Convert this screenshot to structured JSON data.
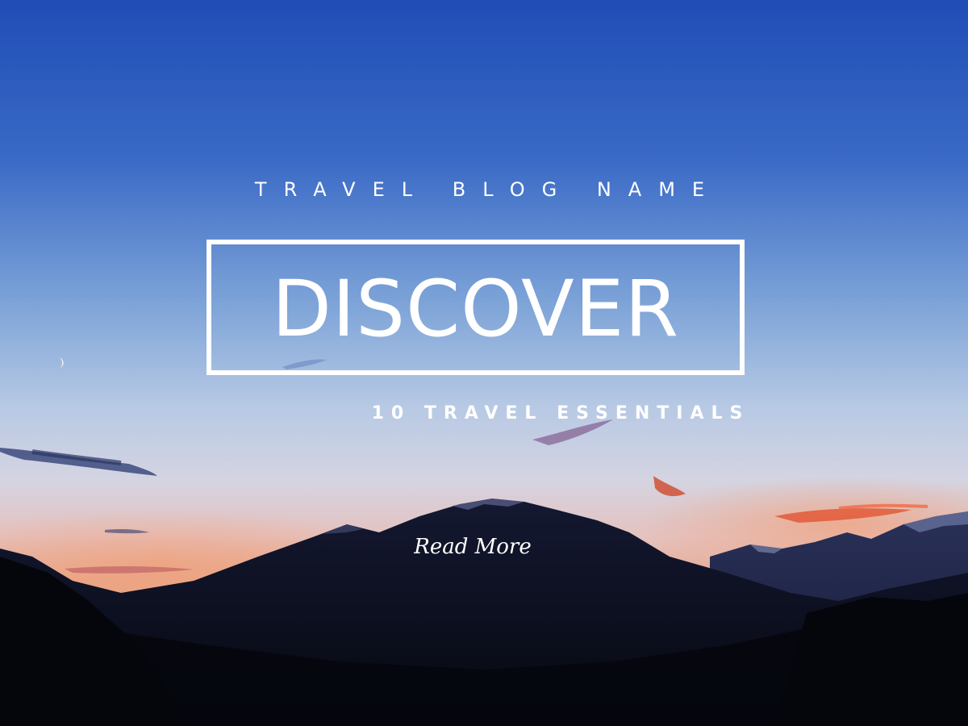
{
  "poster": {
    "blog_name": "TRAVEL BLOG NAME",
    "headline": "DISCOVER",
    "subtitle": "10 TRAVEL ESSENTIALS",
    "read_more_label": "Read More"
  },
  "colors": {
    "sky_top": "#2a54b8",
    "sky_mid": "#8fb3df",
    "horizon_glow": "#e9a487",
    "mountains": "#0b0f22",
    "text": "#ffffff"
  }
}
